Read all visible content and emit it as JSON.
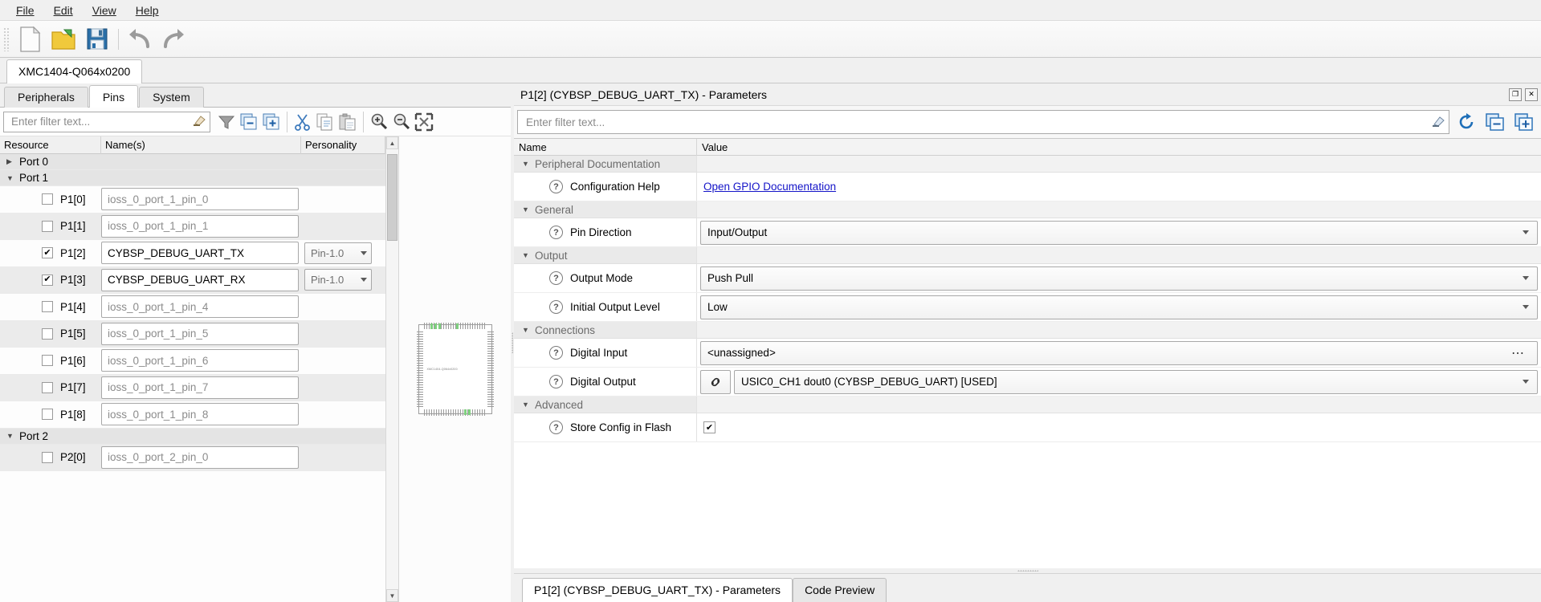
{
  "menu": {
    "items": [
      {
        "label": "File",
        "accel": "F"
      },
      {
        "label": "Edit",
        "accel": "E"
      },
      {
        "label": "View",
        "accel": "V"
      },
      {
        "label": "Help",
        "accel": "H"
      }
    ]
  },
  "toolbar": {
    "buttons": [
      {
        "name": "new-file-icon",
        "tip": "New"
      },
      {
        "name": "open-folder-icon",
        "tip": "Open"
      },
      {
        "name": "save-icon",
        "tip": "Save"
      },
      {
        "name": "undo-icon",
        "tip": "Undo"
      },
      {
        "name": "redo-icon",
        "tip": "Redo"
      }
    ]
  },
  "device_tab": {
    "label": "XMC1404-Q064x0200"
  },
  "sub_tabs": [
    {
      "label": "Peripherals",
      "active": false
    },
    {
      "label": "Pins",
      "active": true
    },
    {
      "label": "System",
      "active": false
    }
  ],
  "pins_filter": {
    "placeholder": "Enter filter text...",
    "value": "",
    "clear_icon": "eraser-icon",
    "tools": [
      {
        "name": "filter-funnel-icon"
      },
      {
        "name": "collapse-all-icon"
      },
      {
        "name": "expand-all-icon"
      },
      {
        "name": "cut-icon"
      },
      {
        "name": "copy-icon"
      },
      {
        "name": "paste-icon"
      },
      {
        "name": "zoom-in-icon"
      },
      {
        "name": "zoom-out-icon"
      },
      {
        "name": "zoom-fit-icon"
      }
    ]
  },
  "pins_table": {
    "columns": [
      "Resource",
      "Name(s)",
      "Personality"
    ],
    "rows": [
      {
        "type": "group",
        "label": "Port 0",
        "expanded": false
      },
      {
        "type": "group",
        "label": "Port 1",
        "expanded": true
      },
      {
        "type": "pin",
        "checked": false,
        "resource": "P1[0]",
        "name": "ioss_0_port_1_pin_0",
        "placeholder": true,
        "personality": ""
      },
      {
        "type": "pin",
        "checked": false,
        "resource": "P1[1]",
        "name": "ioss_0_port_1_pin_1",
        "placeholder": true,
        "personality": ""
      },
      {
        "type": "pin",
        "checked": true,
        "resource": "P1[2]",
        "name": "CYBSP_DEBUG_UART_TX",
        "placeholder": false,
        "personality": "Pin-1.0"
      },
      {
        "type": "pin",
        "checked": true,
        "resource": "P1[3]",
        "name": "CYBSP_DEBUG_UART_RX",
        "placeholder": false,
        "personality": "Pin-1.0"
      },
      {
        "type": "pin",
        "checked": false,
        "resource": "P1[4]",
        "name": "ioss_0_port_1_pin_4",
        "placeholder": true,
        "personality": ""
      },
      {
        "type": "pin",
        "checked": false,
        "resource": "P1[5]",
        "name": "ioss_0_port_1_pin_5",
        "placeholder": true,
        "personality": ""
      },
      {
        "type": "pin",
        "checked": false,
        "resource": "P1[6]",
        "name": "ioss_0_port_1_pin_6",
        "placeholder": true,
        "personality": ""
      },
      {
        "type": "pin",
        "checked": false,
        "resource": "P1[7]",
        "name": "ioss_0_port_1_pin_7",
        "placeholder": true,
        "personality": ""
      },
      {
        "type": "pin",
        "checked": false,
        "resource": "P1[8]",
        "name": "ioss_0_port_1_pin_8",
        "placeholder": true,
        "personality": ""
      },
      {
        "type": "group",
        "label": "Port 2",
        "expanded": true
      },
      {
        "type": "pin",
        "checked": false,
        "resource": "P2[0]",
        "name": "ioss_0_port_2_pin_0",
        "placeholder": true,
        "personality": ""
      }
    ]
  },
  "parameters_panel": {
    "title": "P1[2] (CYBSP_DEBUG_UART_TX) - Parameters",
    "window_buttons": [
      {
        "name": "restore-window-icon",
        "glyph": "❐"
      },
      {
        "name": "close-window-icon",
        "glyph": "✕"
      }
    ],
    "filter": {
      "placeholder": "Enter filter text...",
      "value": "",
      "clear_icon": "eraser-icon"
    },
    "actions": [
      {
        "name": "refresh-icon",
        "glyph": "↻"
      },
      {
        "name": "collapse-all-icon"
      },
      {
        "name": "expand-all-icon"
      }
    ],
    "columns": [
      "Name",
      "Value"
    ],
    "rows": [
      {
        "kind": "group",
        "label": "Peripheral Documentation",
        "expanded": true
      },
      {
        "kind": "link",
        "label": "Configuration Help",
        "value": "Open GPIO Documentation"
      },
      {
        "kind": "group",
        "label": "General",
        "expanded": true
      },
      {
        "kind": "combo",
        "label": "Pin Direction",
        "value": "Input/Output"
      },
      {
        "kind": "group",
        "label": "Output",
        "expanded": true
      },
      {
        "kind": "combo",
        "label": "Output Mode",
        "value": "Push Pull"
      },
      {
        "kind": "combo",
        "label": "Initial Output Level",
        "value": "Low"
      },
      {
        "kind": "group",
        "label": "Connections",
        "expanded": true
      },
      {
        "kind": "ellipsis",
        "label": "Digital Input",
        "value": "<unassigned>"
      },
      {
        "kind": "combolink",
        "label": "Digital Output",
        "value": "USIC0_CH1 dout0 (CYBSP_DEBUG_UART) [USED]",
        "link_icon": "chain-link-icon"
      },
      {
        "kind": "group",
        "label": "Advanced",
        "expanded": true
      },
      {
        "kind": "checkbox",
        "label": "Store Config in Flash",
        "checked": true
      }
    ]
  },
  "bottom_tabs": [
    {
      "label": "P1[2] (CYBSP_DEBUG_UART_TX) - Parameters",
      "active": true
    },
    {
      "label": "Code Preview",
      "active": false
    }
  ]
}
